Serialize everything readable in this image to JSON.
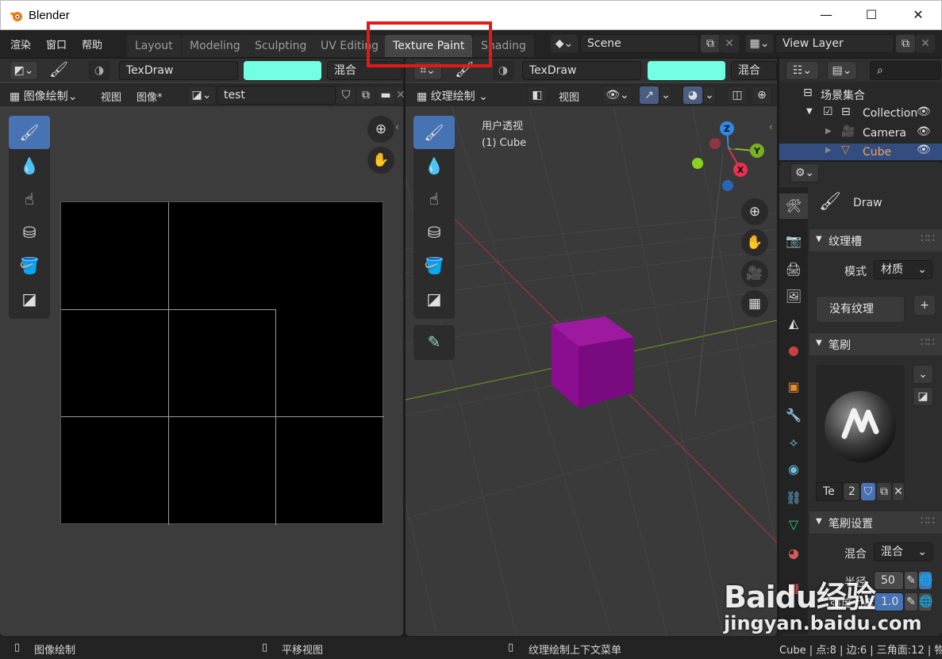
{
  "window": {
    "title": "Blender",
    "min": "—",
    "max": "☐",
    "close": "✕"
  },
  "menubar": {
    "items": [
      "渲染",
      "窗口",
      "帮助"
    ]
  },
  "workspaces": [
    "Layout",
    "Modeling",
    "Sculpting",
    "UV Editing",
    "Texture Paint",
    "Shading"
  ],
  "active_workspace": "Texture Paint",
  "scene": {
    "name": "Scene",
    "view_layer": "View Layer"
  },
  "image_editor": {
    "brush_name": "TexDraw",
    "blend_label": "混合",
    "swatch_color": "#73ffe4",
    "mode": "图像绘制",
    "menu_view": "视图",
    "menu_image": "图像*",
    "image_name": "test"
  },
  "viewport": {
    "brush_name": "TexDraw",
    "blend_label": "混合",
    "mode": "纹理绘制",
    "menu_view": "视图",
    "overlay_line1": "用户透视",
    "overlay_line2": "(1) Cube",
    "gizmo": {
      "z": "Z",
      "y": "Y",
      "x": "X"
    },
    "cube_color": "#8a0e8f"
  },
  "outliner": {
    "scene_collection": "场景集合",
    "collection": "Collection",
    "camera": "Camera",
    "cube": "Cube"
  },
  "properties": {
    "tool_name": "Draw",
    "texture_slots": "纹理槽",
    "mode_label": "模式",
    "mode_value": "材质",
    "no_texture": "没有纹理",
    "brushes": "笔刷",
    "brush_field": "Te",
    "brush_users": "2",
    "brush_settings": "笔刷设置",
    "blend_label": "混合",
    "blend_value": "混合",
    "radius_label": "半径",
    "radius_value": "50",
    "strength_label": "强度力度",
    "strength_value": "1.0"
  },
  "statusbar": {
    "left": "图像绘制",
    "middle": "平移视图",
    "right": "纹理绘制上下文菜单",
    "stats": "Cube | 点:8 | 边:6 | 三角面:12 | 物"
  },
  "watermark": {
    "brand": "Baidu经验",
    "url": "jingyan.baidu.com"
  }
}
